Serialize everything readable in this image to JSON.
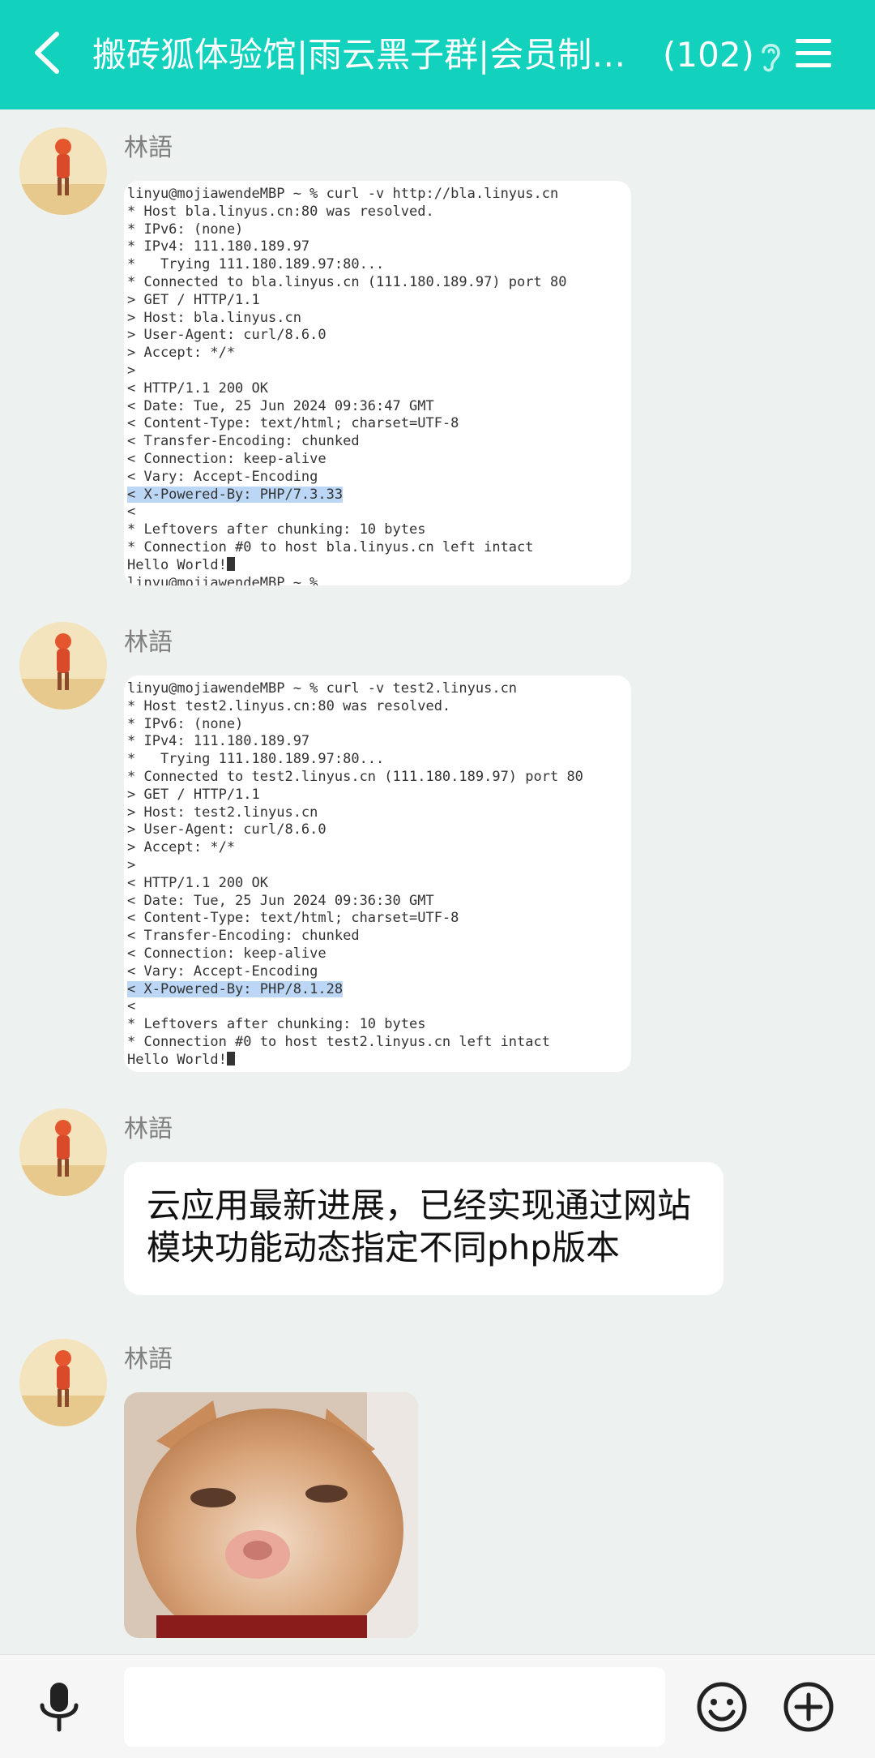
{
  "header": {
    "title": "搬砖狐体验馆|雨云黑子群|会员制…",
    "member_count": "(102)",
    "icons": [
      "back-arrow-icon",
      "ear-icon",
      "menu-icon"
    ]
  },
  "colors": {
    "header_bg": "#12d2be",
    "chat_bg": "#edf1ef",
    "highlight": "#bcd7f5"
  },
  "messages": [
    {
      "sender": "林語",
      "type": "image-terminal",
      "lines": [
        "linyu@mojiawendeMBP ~ % curl -v http://bla.linyus.cn",
        "* Host bla.linyus.cn:80 was resolved.",
        "* IPv6: (none)",
        "* IPv4: 111.180.189.97",
        "*   Trying 111.180.189.97:80...",
        "* Connected to bla.linyus.cn (111.180.189.97) port 80",
        "> GET / HTTP/1.1",
        "> Host: bla.linyus.cn",
        "> User-Agent: curl/8.6.0",
        "> Accept: */*",
        ">",
        "< HTTP/1.1 200 OK",
        "< Date: Tue, 25 Jun 2024 09:36:47 GMT",
        "< Content-Type: text/html; charset=UTF-8",
        "< Transfer-Encoding: chunked",
        "< Connection: keep-alive",
        "< Vary: Accept-Encoding",
        "< X-Powered-By: PHP/7.3.33",
        "<",
        "* Leftovers after chunking: 10 bytes",
        "* Connection #0 to host bla.linyus.cn left intact",
        "Hello World!",
        "linyu@mojiawendeMBP ~ %"
      ]
    },
    {
      "sender": "林語",
      "type": "image-terminal",
      "lines": [
        "linyu@mojiawendeMBP ~ % curl -v test2.linyus.cn",
        "* Host test2.linyus.cn:80 was resolved.",
        "* IPv6: (none)",
        "* IPv4: 111.180.189.97",
        "*   Trying 111.180.189.97:80...",
        "* Connected to test2.linyus.cn (111.180.189.97) port 80",
        "> GET / HTTP/1.1",
        "> Host: test2.linyus.cn",
        "> User-Agent: curl/8.6.0",
        "> Accept: */*",
        ">",
        "< HTTP/1.1 200 OK",
        "< Date: Tue, 25 Jun 2024 09:36:30 GMT",
        "< Content-Type: text/html; charset=UTF-8",
        "< Transfer-Encoding: chunked",
        "< Connection: keep-alive",
        "< Vary: Accept-Encoding",
        "< X-Powered-By: PHP/8.1.28",
        "<",
        "* Leftovers after chunking: 10 bytes",
        "* Connection #0 to host test2.linyus.cn left intact",
        "Hello World!"
      ]
    },
    {
      "sender": "林語",
      "type": "text",
      "text": "云应用最新进展，已经实现通过网站模块功能动态指定不同php版本"
    },
    {
      "sender": "林語",
      "type": "image-photo",
      "icon": "cat-photo"
    }
  ],
  "input_bar": {
    "placeholder": "",
    "icons": [
      "microphone-icon",
      "emoji-icon",
      "plus-icon"
    ]
  }
}
